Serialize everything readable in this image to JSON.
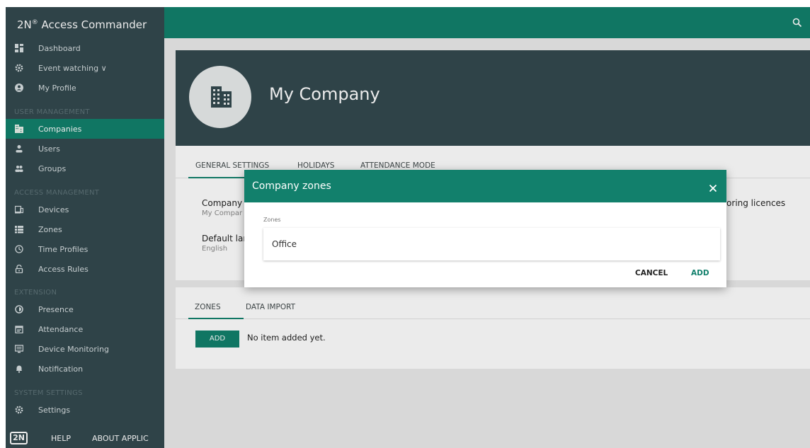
{
  "app": {
    "title": "2N",
    "title_sup": "®",
    "title_rest": " Access Commander",
    "search_icon": "search-icon"
  },
  "colors": {
    "brand_green": "#12806c",
    "sidebar_bg": "#34494f",
    "content_bg": "#ebebeb"
  },
  "sidebar": {
    "items": [
      {
        "label": "Dashboard",
        "icon": "dashboard-icon"
      },
      {
        "label": "Event watching ∨",
        "icon": "gear-icon"
      },
      {
        "label": "My Profile",
        "icon": "account-circle-icon"
      },
      {
        "label": "Companies",
        "icon": "building-icon",
        "active": true
      },
      {
        "label": "Users",
        "icon": "user-icon"
      },
      {
        "label": "Groups",
        "icon": "group-icon"
      },
      {
        "label": "Devices",
        "icon": "devices-icon"
      },
      {
        "label": "Zones",
        "icon": "zones-icon"
      },
      {
        "label": "Time Profiles",
        "icon": "clock-icon"
      },
      {
        "label": "Access Rules",
        "icon": "lock-icon"
      },
      {
        "label": "Presence",
        "icon": "presence-icon"
      },
      {
        "label": "Attendance",
        "icon": "calendar-icon"
      },
      {
        "label": "Device Monitoring",
        "icon": "monitor-icon"
      },
      {
        "label": "Notification",
        "icon": "bell-icon"
      },
      {
        "label": "Settings",
        "icon": "gear-icon"
      }
    ],
    "sections": {
      "user_management": "USER MANAGEMENT",
      "access_management": "ACCESS MANAGEMENT",
      "extension": "EXTENSION",
      "system_settings": "SYSTEM SETTINGS"
    },
    "footer": {
      "logo": "2N",
      "help": "HELP",
      "about": "ABOUT APPLIC"
    }
  },
  "company": {
    "title": "My Company",
    "avatar_icon": "building-icon"
  },
  "settings_tabs": [
    "GENERAL SETTINGS",
    "HOLIDAYS",
    "ATTENDANCE MODE"
  ],
  "general_settings": {
    "company_label": "Company",
    "company_value": "My Compar",
    "language_label": "Default lar",
    "language_value": "English",
    "monitoring_label": "itoring licences"
  },
  "zones_tabs": [
    "ZONES",
    "DATA IMPORT"
  ],
  "zones_panel": {
    "add_label": "ADD",
    "empty_message": "No item added yet."
  },
  "dialog": {
    "title": "Company zones",
    "close_icon": "close-icon",
    "field_label": "Zones",
    "field_value": "Office",
    "cancel_label": "CANCEL",
    "add_label": "ADD"
  }
}
